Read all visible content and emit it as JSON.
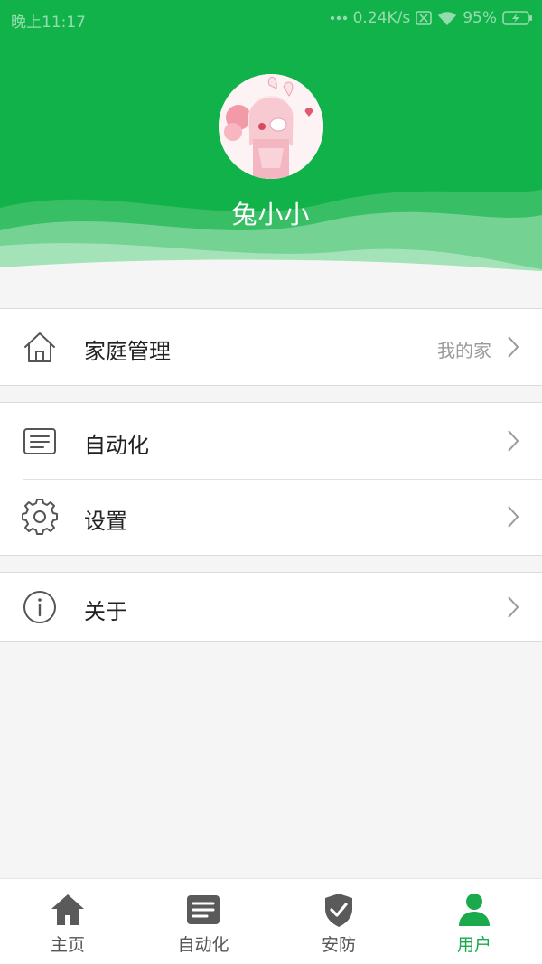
{
  "status_bar": {
    "time": "晚上11:17",
    "network_speed": "0.24K/s",
    "battery": "95%"
  },
  "profile": {
    "username": "兔小小"
  },
  "menu": {
    "family": {
      "label": "家庭管理",
      "value": "我的家"
    },
    "automation": {
      "label": "自动化"
    },
    "settings": {
      "label": "设置"
    },
    "about": {
      "label": "关于"
    }
  },
  "bottom_nav": {
    "items": [
      {
        "label": "主页",
        "icon": "home-icon"
      },
      {
        "label": "自动化",
        "icon": "automation-icon"
      },
      {
        "label": "安防",
        "icon": "shield-icon"
      },
      {
        "label": "用户",
        "icon": "user-icon"
      }
    ],
    "active": "用户"
  },
  "colors": {
    "brand_green": "#12b24a",
    "active_tab": "#1aa94b"
  }
}
